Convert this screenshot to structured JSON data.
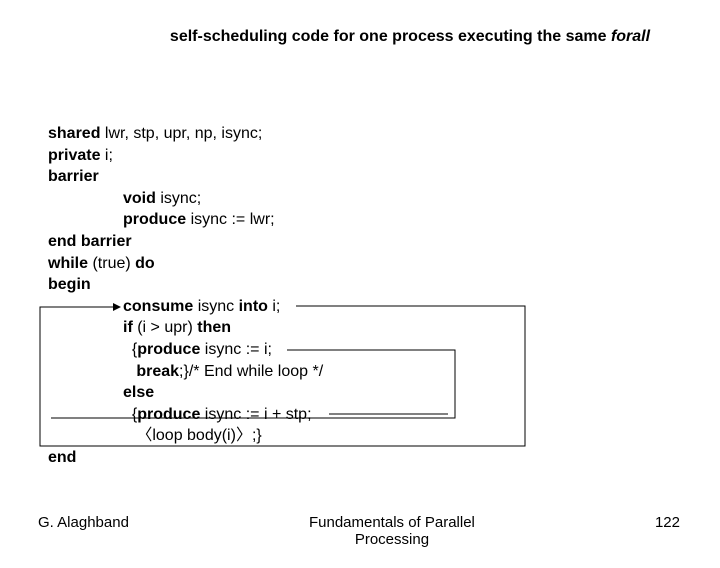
{
  "title": {
    "prefix": "self-scheduling code for one process executing the same ",
    "em": "forall"
  },
  "code": {
    "l1a": "shared",
    "l1b": " lwr, stp, upr, np, isync;",
    "l2a": "private",
    "l2b": " i;",
    "l3": "barrier",
    "l4a": "void",
    "l4b": " isync;",
    "l5a": "produce",
    "l5b": " isync := lwr;",
    "l6": "end barrier",
    "l7a": "while",
    "l7b": " (true) ",
    "l7c": "do",
    "l8": "begin",
    "l9a": "consume",
    "l9b": " isync ",
    "l9c": "into",
    "l9d": " i;",
    "l10a": "if",
    "l10b": " (i > upr) ",
    "l10c": "then",
    "l11a": "  {",
    "l11b": "produce",
    "l11c": " isync := i;",
    "l12a": "   ",
    "l12b": "break",
    "l12c": ";}/* End while loop */",
    "l13": "else",
    "l14a": "  {",
    "l14b": "produce",
    "l14c": " isync := i + stp;",
    "l15": "   〈loop body(i)〉;}",
    "l16": "end"
  },
  "footer": {
    "left": "G. Alaghband",
    "center1": "Fundamentals of Parallel",
    "center2": "Processing",
    "right": "122"
  }
}
